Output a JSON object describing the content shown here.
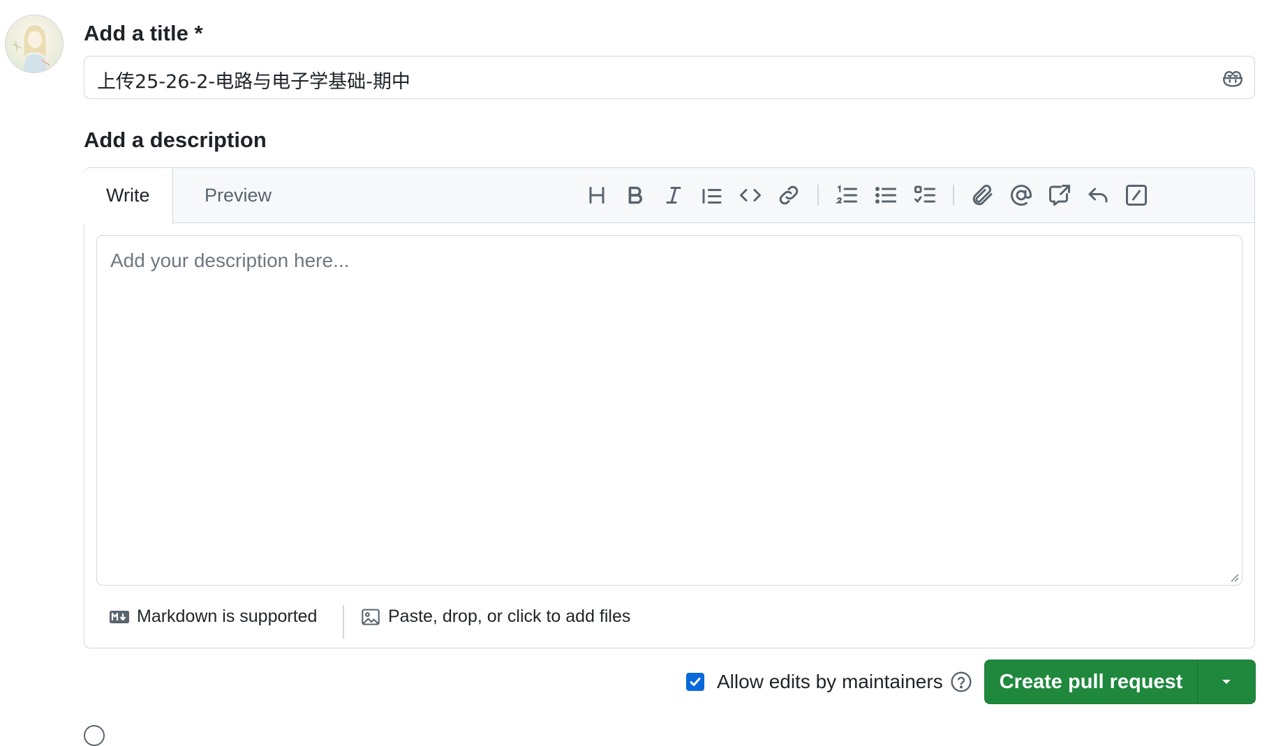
{
  "title_section": {
    "label": "Add a title *",
    "value": "上传25-26-2-电路与电子学基础-期中",
    "copilot_icon": "copilot-icon"
  },
  "description_section": {
    "label": "Add a description",
    "tabs": [
      {
        "label": "Write",
        "active": true
      },
      {
        "label": "Preview",
        "active": false
      }
    ],
    "toolbar_icons": [
      "heading-icon",
      "bold-icon",
      "italic-icon",
      "quote-icon",
      "code-icon",
      "link-icon",
      "ordered-list-icon",
      "unordered-list-icon",
      "task-list-icon",
      "attach-icon",
      "mention-icon",
      "cross-reference-icon",
      "reply-icon",
      "slash-command-icon"
    ],
    "placeholder": "Add your description here...",
    "footer": {
      "markdown": "Markdown is supported",
      "files": "Paste, drop, or click to add files"
    }
  },
  "actions": {
    "allow_edits_label": "Allow edits by maintainers",
    "allow_edits_checked": true,
    "create_button": "Create pull request"
  },
  "colors": {
    "primary_green": "#1f883d",
    "checkbox_blue": "#0969da",
    "border": "#d0d7de",
    "header_bg": "#f6f8fa"
  }
}
